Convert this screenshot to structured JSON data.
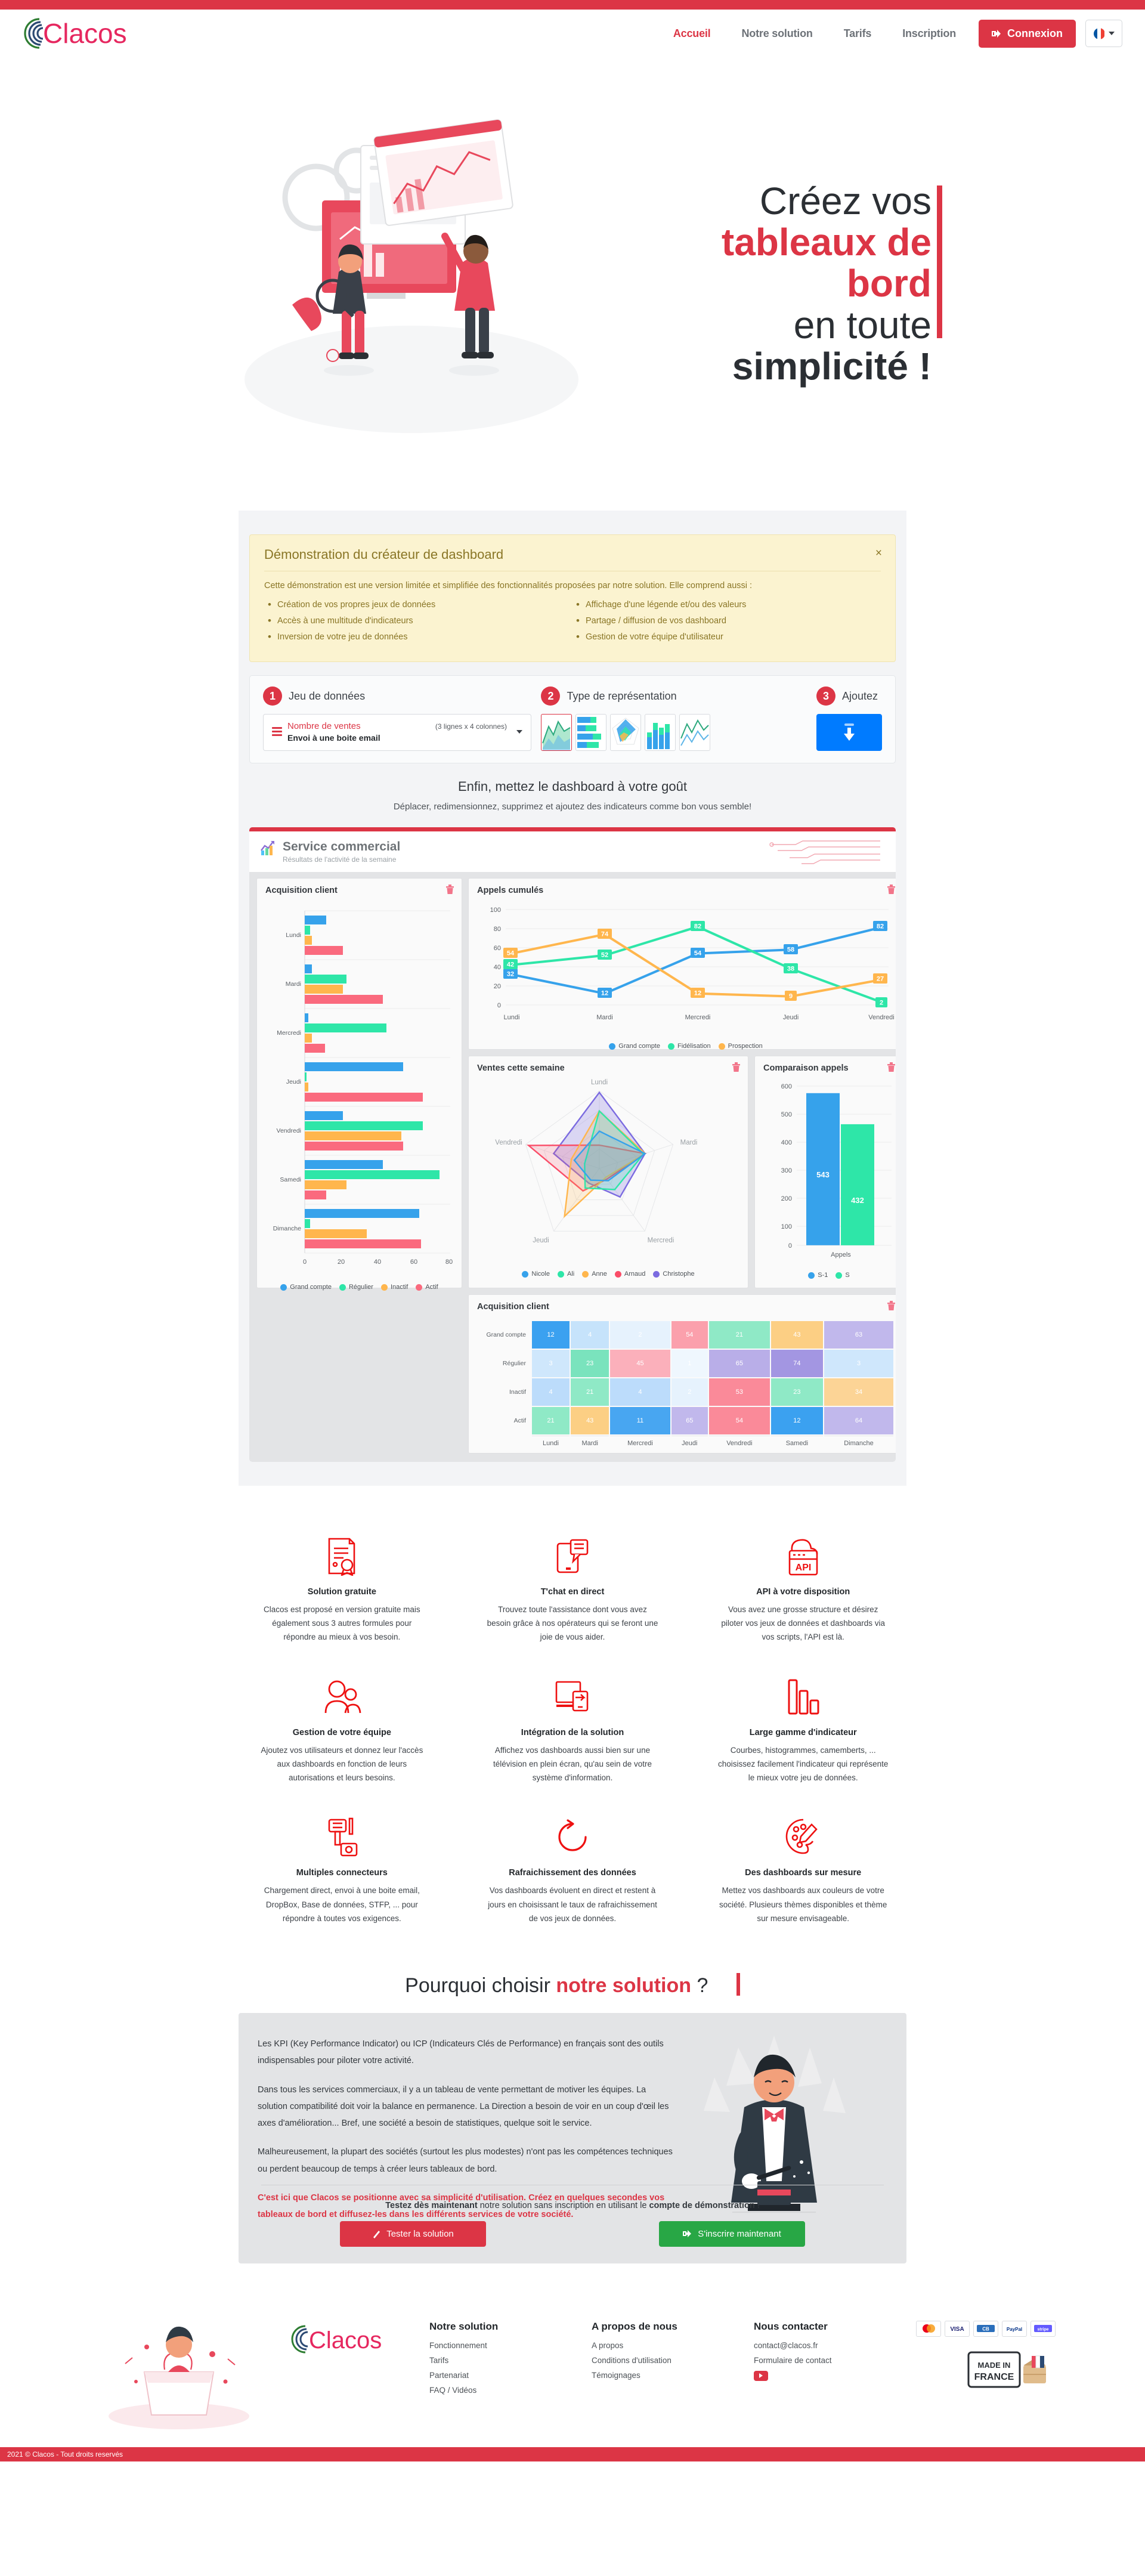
{
  "brand": {
    "name": "Clacos",
    "accent": "#dc3545",
    "green": "#28a745",
    "blue": "#007bff"
  },
  "header": {
    "nav": [
      {
        "label": "Accueil",
        "active": true
      },
      {
        "label": "Notre solution",
        "active": false
      },
      {
        "label": "Tarifs",
        "active": false
      },
      {
        "label": "Inscription",
        "active": false
      }
    ],
    "login_label": "Connexion",
    "lang": "FR"
  },
  "hero": {
    "line1": "Créez vos",
    "line2": "tableaux de bord",
    "line3_pre": "en toute ",
    "line3_strong": "simplicité !"
  },
  "demo": {
    "alert": {
      "title": "Démonstration du créateur de dashboard",
      "close": "×",
      "intro": "Cette démonstration est une version limitée et simplifiée des fonctionnalités proposées par notre solution. Elle comprend aussi :",
      "left_items": [
        "Création de vos propres jeux de données",
        "Accès à une multitude d'indicateurs",
        "Inversion de votre jeu de données"
      ],
      "right_items": [
        "Affichage d'une légende et/ou des valeurs",
        "Partage / diffusion de vos dashboard",
        "Gestion de votre équipe d'utilisateur"
      ]
    },
    "steps": [
      {
        "num": "1",
        "title": "Jeu de données"
      },
      {
        "num": "2",
        "title": "Type de représentation"
      },
      {
        "num": "3",
        "title": "Ajoutez"
      }
    ],
    "dataset": {
      "name": "Nombre de ventes",
      "dims": "(3 lignes x 4 colonnes)",
      "source": "Envoi à une boite email"
    },
    "chart_types": [
      "area-chart-icon",
      "stacked-hbar-icon",
      "radar-icon",
      "stacked-bar-icon",
      "line-chart-icon"
    ],
    "tagline_title": "Enfin, mettez le dashboard à votre goût",
    "tagline_sub": "Déplacer, redimensionnez, supprimez et ajoutez des indicateurs comme bon vous semble!"
  },
  "dashboard": {
    "title": "Service commercial",
    "subtitle": "Résultats de l'activité de la semaine",
    "cards": [
      {
        "title": "Acquisition client"
      },
      {
        "title": "Appels cumulés"
      },
      {
        "title": "Ventes cette semaine"
      },
      {
        "title": "Comparaison appels"
      },
      {
        "title": "Acquisition client"
      }
    ]
  },
  "chart_data": [
    {
      "type": "bar",
      "title": "Acquisition client",
      "orientation": "horizontal",
      "categories": [
        "Lundi",
        "Mardi",
        "Mercredi",
        "Jeudi",
        "Vendredi",
        "Samedi",
        "Dimanche"
      ],
      "series": [
        {
          "name": "Grand compte",
          "color": "#36a2eb",
          "values": [
            12,
            4,
            2,
            54,
            21,
            43,
            63
          ]
        },
        {
          "name": "Régulier",
          "color": "#2ee6a8",
          "values": [
            3,
            23,
            45,
            1,
            65,
            74,
            3
          ]
        },
        {
          "name": "Inactif",
          "color": "#ffb64d",
          "values": [
            4,
            21,
            4,
            2,
            53,
            23,
            34
          ]
        },
        {
          "name": "Actif",
          "color": "#fa6a7e",
          "values": [
            21,
            43,
            11,
            65,
            54,
            12,
            64
          ]
        }
      ],
      "xlim": [
        0,
        80
      ],
      "xticks": [
        0,
        20,
        40,
        60,
        80
      ],
      "legend": "bottom",
      "grid": true
    },
    {
      "type": "line",
      "title": "Appels cumulés",
      "categories": [
        "Lundi",
        "Mardi",
        "Mercredi",
        "Jeudi",
        "Vendredi"
      ],
      "series": [
        {
          "name": "Grand compte",
          "color": "#36a2eb",
          "values": [
            32,
            12,
            54,
            58,
            82
          ]
        },
        {
          "name": "Fidélisation",
          "color": "#2ee6a8",
          "values": [
            42,
            52,
            82,
            38,
            2
          ]
        },
        {
          "name": "Prospection",
          "color": "#ffb64d",
          "values": [
            54,
            74,
            12,
            9,
            27
          ]
        }
      ],
      "ylim": [
        0,
        100
      ],
      "yticks": [
        0,
        20,
        40,
        60,
        80,
        100
      ],
      "data_labels": true,
      "legend": "bottom",
      "grid": true
    },
    {
      "type": "radar",
      "title": "Ventes cette semaine",
      "categories": [
        "Lundi",
        "Mardi",
        "Mercredi",
        "Jeudi",
        "Vendredi"
      ],
      "series": [
        {
          "name": "Nicole",
          "color": "#36a2eb",
          "values": [
            48,
            62,
            30,
            24,
            34
          ]
        },
        {
          "name": "Ali",
          "color": "#2ee6a8",
          "values": [
            74,
            60,
            52,
            40,
            20
          ]
        },
        {
          "name": "Anne",
          "color": "#ffb64d",
          "values": [
            74,
            62,
            22,
            98,
            38
          ]
        },
        {
          "name": "Arnaud",
          "color": "#fa4d68",
          "values": [
            30,
            62,
            26,
            46,
            96
          ]
        },
        {
          "name": "Christophe",
          "color": "#7b6be0",
          "values": [
            98,
            62,
            70,
            30,
            62
          ]
        }
      ],
      "rmax": 100,
      "legend": "bottom"
    },
    {
      "type": "bar",
      "title": "Comparaison appels",
      "categories": [
        "Appels"
      ],
      "series": [
        {
          "name": "S-1",
          "color": "#36a2eb",
          "values": [
            543
          ]
        },
        {
          "name": "S",
          "color": "#2ee6a8",
          "values": [
            432
          ]
        }
      ],
      "ylim": [
        0,
        600
      ],
      "yticks": [
        0,
        100,
        200,
        300,
        400,
        500,
        600
      ],
      "data_labels": true,
      "legend": "bottom",
      "grid": true
    },
    {
      "type": "heatmap",
      "title": "Acquisition client",
      "columns": [
        "Lundi",
        "Mardi",
        "Mercredi",
        "Jeudi",
        "Vendredi",
        "Samedi",
        "Dimanche"
      ],
      "rows": [
        "Grand compte",
        "Régulier",
        "Inactif",
        "Actif"
      ],
      "values": [
        [
          12,
          4,
          2,
          54,
          21,
          43,
          63
        ],
        [
          3,
          23,
          45,
          1,
          65,
          74,
          3
        ],
        [
          4,
          21,
          4,
          2,
          53,
          23,
          34
        ],
        [
          21,
          43,
          11,
          65,
          54,
          12,
          64
        ]
      ],
      "cell_colors": [
        [
          "#3ba1f0",
          "#c6e3fb",
          "#e6f2fd",
          "#fba0ac",
          "#8fe9c6",
          "#fccf84",
          "#c1b8ec"
        ],
        [
          "#cfe7fc",
          "#7ae3bd",
          "#fbb0bb",
          "#eff7fe",
          "#b9aee8",
          "#a396e2",
          "#cfe7fc"
        ],
        [
          "#bcdcfb",
          "#8fe9c6",
          "#bcdcfb",
          "#e6f2fd",
          "#fa8a99",
          "#8fe9c6",
          "#fcd496"
        ],
        [
          "#8fe9c6",
          "#fccf84",
          "#48a6f1",
          "#c1b8ec",
          "#fa8a99",
          "#3ba1f0",
          "#c1b8ec"
        ]
      ]
    }
  ],
  "features": [
    {
      "icon": "certificate-icon",
      "title": "Solution gratuite",
      "text": "Clacos est proposé en version gratuite mais également sous 3 autres formules pour répondre au mieux à vos besoin."
    },
    {
      "icon": "chat-mobile-icon",
      "title": "T'chat en direct",
      "text": "Trouvez toute l'assistance dont vous avez besoin grâce à nos opérateurs qui se feront une joie de vous aider."
    },
    {
      "icon": "api-cloud-icon",
      "title": "API à votre disposition",
      "text": "Vous avez une grosse structure et désirez piloter vos jeux de données et dashboards via vos scripts, l'API est là."
    },
    {
      "icon": "team-users-icon",
      "title": "Gestion de votre équipe",
      "text": "Ajoutez vos utilisateurs et donnez leur l'accès aux dashboards en fonction de leurs autorisations et leurs besoins."
    },
    {
      "icon": "integration-screens-icon",
      "title": "Intégration de la solution",
      "text": "Affichez vos dashboards aussi bien sur une télévision en plein écran, qu'au sein de votre système d'information."
    },
    {
      "icon": "bar-indicator-icon",
      "title": "Large gamme d'indicateur",
      "text": "Courbes, histogrammes, camemberts, ... choisissez facilement l'indicateur qui représente le mieux votre jeu de données."
    },
    {
      "icon": "connectors-plug-icon",
      "title": "Multiples connecteurs",
      "text": "Chargement direct, envoi à une boite email, DropBox, Base de données, STFP, ... pour répondre à toutes vos exigences."
    },
    {
      "icon": "refresh-arrow-icon",
      "title": "Rafraichissement des données",
      "text": "Vos dashboards évoluent en direct et restent à jours en choisissant le taux de rafraichissement de vos jeux de données."
    },
    {
      "icon": "palette-brush-icon",
      "title": "Des dashboards sur mesure",
      "text": "Mettez vos dashboards aux couleurs de votre société. Plusieurs thèmes disponibles et thème sur mesure envisageable."
    }
  ],
  "why": {
    "title_pre": "Pourquoi choisir ",
    "title_red": "notre solution",
    "title_post": " ?",
    "paragraphs": [
      "Les KPI (Key Performance Indicator) ou ICP (Indicateurs Clés de Performance) en français sont des outils indispensables pour piloter votre activité.",
      "Dans tous les services commerciaux, il y a un tableau de vente permettant de motiver les équipes. La solution compatibilité doit voir la balance en permanence. La Direction a besoin de voir en un coup d'œil les axes d'amélioration... Bref, une société a besoin de statistiques, quelque soit le service.",
      "Malheureusement, la plupart des sociétés (surtout les plus modestes) n'ont pas les compétences techniques ou perdent beaucoup de temps à créer leurs tableaux de bord.",
      "C'est ici que Clacos se positionne avec sa simplicité d'utilisation. Créez en quelques secondes vos tableaux de bord et diffusez-les dans les différents services de votre société."
    ],
    "cta_text_pre": "Testez dès maintenant",
    "cta_text_mid": " notre solution sans inscription en utilisant le ",
    "cta_text_strong": "compte de démonstration",
    "cta_text_end": " !",
    "btn_test": "Tester la solution",
    "btn_signup": "S'inscrire maintenant"
  },
  "footer": {
    "col1": {
      "title": "Notre solution",
      "links": [
        "Fonctionnement",
        "Tarifs",
        "Partenariat",
        "FAQ / Vidéos"
      ]
    },
    "col2": {
      "title": "A propos de nous",
      "links": [
        "A propos",
        "Conditions d'utilisation",
        "Témoignages"
      ]
    },
    "col3": {
      "title": "Nous contacter",
      "links": [
        "contact@clacos.fr",
        "Formulaire de contact"
      ]
    },
    "payments": [
      "mastercard",
      "visa",
      "cb",
      "paypal",
      "stripe"
    ],
    "made_in": {
      "l1": "MADE IN",
      "l2": "FRANCE"
    },
    "copyright": "2021 © Clacos - Tout droits reservés"
  }
}
